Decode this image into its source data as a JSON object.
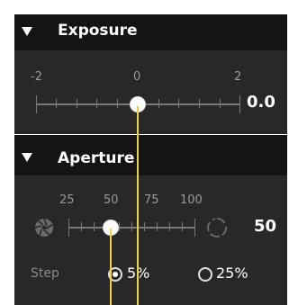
{
  "exposure": {
    "title": "Exposure",
    "min_label": "-2",
    "mid_label": "0",
    "max_label": "2",
    "value": "0.0",
    "level": 0.5
  },
  "aperture": {
    "title": "Aperture",
    "tick_labels": [
      "25",
      "50",
      "75",
      "100"
    ],
    "value": "50",
    "level": 0.3
  },
  "step": {
    "label": "Step",
    "options": [
      {
        "label": "5%",
        "selected": true
      },
      {
        "label": "25%",
        "selected": false
      }
    ]
  },
  "colors": {
    "guide": "#f3cf3a",
    "panel": "#282828",
    "header": "#141414"
  },
  "icons": {
    "collapse": "triangle-down-icon",
    "iris_closed": "aperture-closed-icon",
    "iris_open": "aperture-open-icon"
  }
}
